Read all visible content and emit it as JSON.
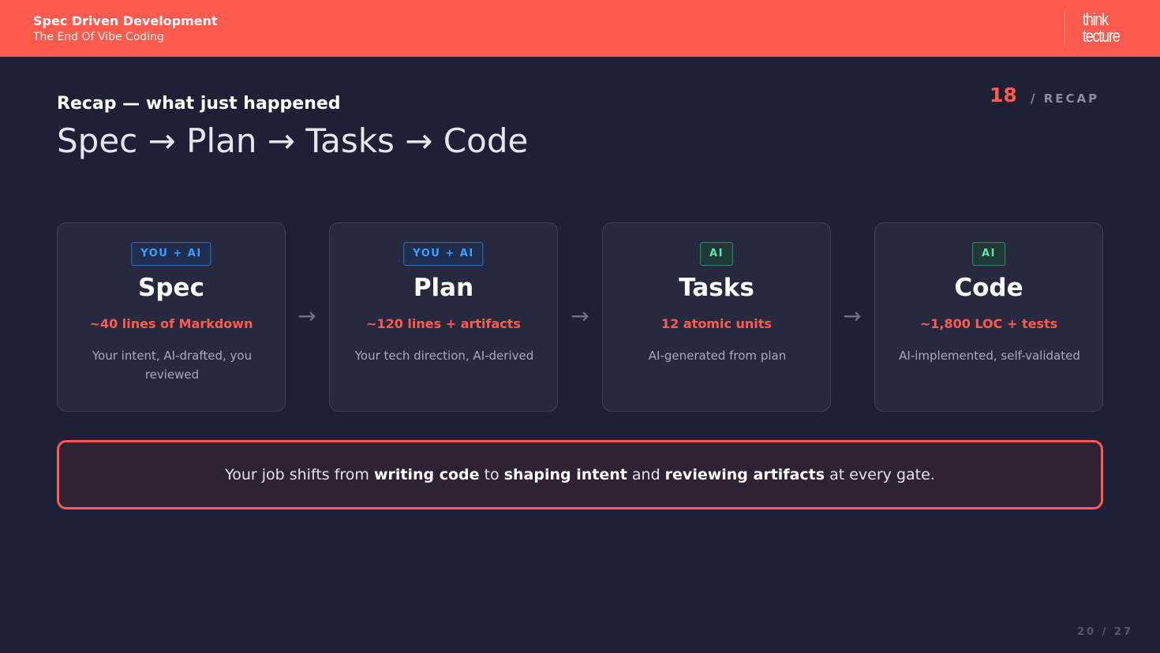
{
  "header": {
    "title": "Spec Driven Development",
    "subtitle": "The End Of Vibe Coding",
    "logo_line1": "think",
    "logo_line2": "tecture",
    "brand_color": "#ff5a4e"
  },
  "slide": {
    "number": "18",
    "section": "/ RECAP",
    "kicker": "Recap — what just happened",
    "flow_title": "Spec → Plan → Tasks → Code"
  },
  "cards": [
    {
      "badge": "YOU + AI",
      "title": "Spec",
      "metric": "~40 lines of Markdown",
      "desc": "Your intent, AI-drafted, you reviewed"
    },
    {
      "badge": "YOU + AI",
      "title": "Plan",
      "metric": "~120 lines + artifacts",
      "desc": "Your tech direction, AI-derived"
    },
    {
      "badge": "AI",
      "title": "Tasks",
      "metric": "12 atomic units",
      "desc": "AI-generated from plan"
    },
    {
      "badge": "AI",
      "title": "Code",
      "metric": "~1,800 LOC + tests",
      "desc": "AI-implemented, self-validated"
    }
  ],
  "arrow_glyph": "→",
  "callout": {
    "p1": "Your job shifts from ",
    "b1": "writing code",
    "p2": " to ",
    "b2": "shaping intent",
    "p3": " and ",
    "b3": "reviewing artifacts",
    "p4": " at every gate."
  },
  "pager": "20 / 27"
}
